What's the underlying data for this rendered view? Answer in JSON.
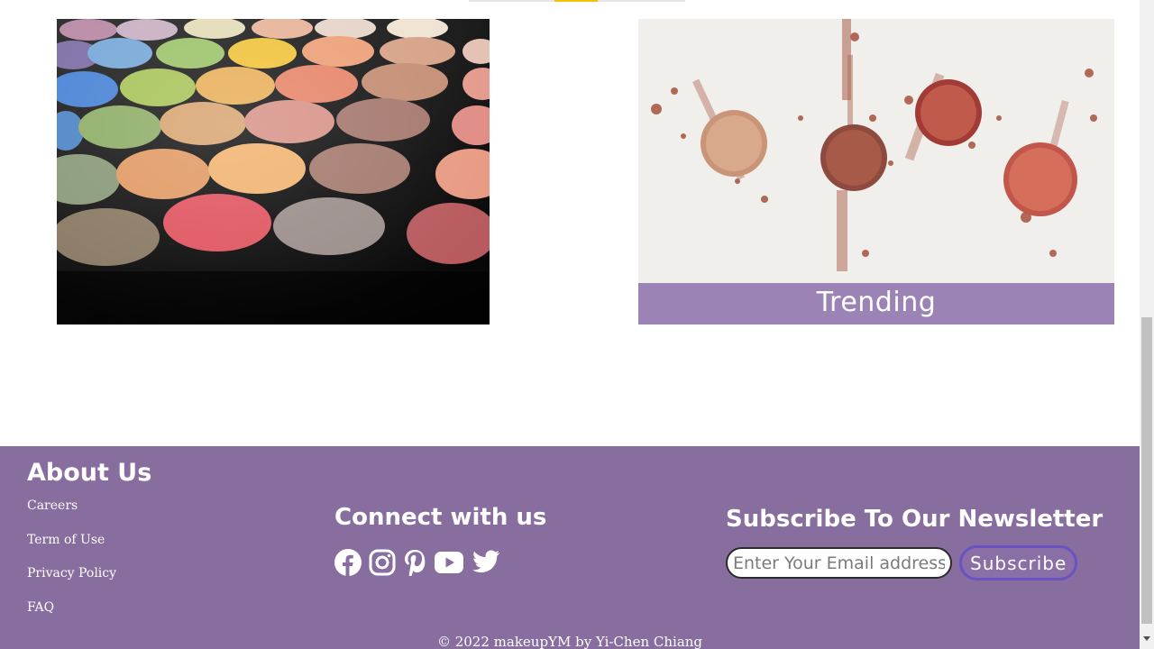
{
  "gallery": {
    "trending_caption": "Trending"
  },
  "footer": {
    "about_title": "About Us",
    "about_links": [
      "Careers",
      "Term of Use",
      "Privacy Policy",
      "FAQ"
    ],
    "connect_title": "Connect with us",
    "social_icons": [
      "facebook-icon",
      "instagram-icon",
      "pinterest-icon",
      "youtube-icon",
      "twitter-icon"
    ],
    "newsletter_title": "Subscribe To Our Newsletter",
    "email_placeholder": "Enter Your Email address",
    "subscribe_label": "Subscribe",
    "copyright": "© 2022 makeupYM by Yi-Chen Chiang"
  },
  "colors": {
    "footer_bg": "#886d9f",
    "caption_bg": "#947bb0",
    "subscribe_border": "#6a52c0"
  }
}
